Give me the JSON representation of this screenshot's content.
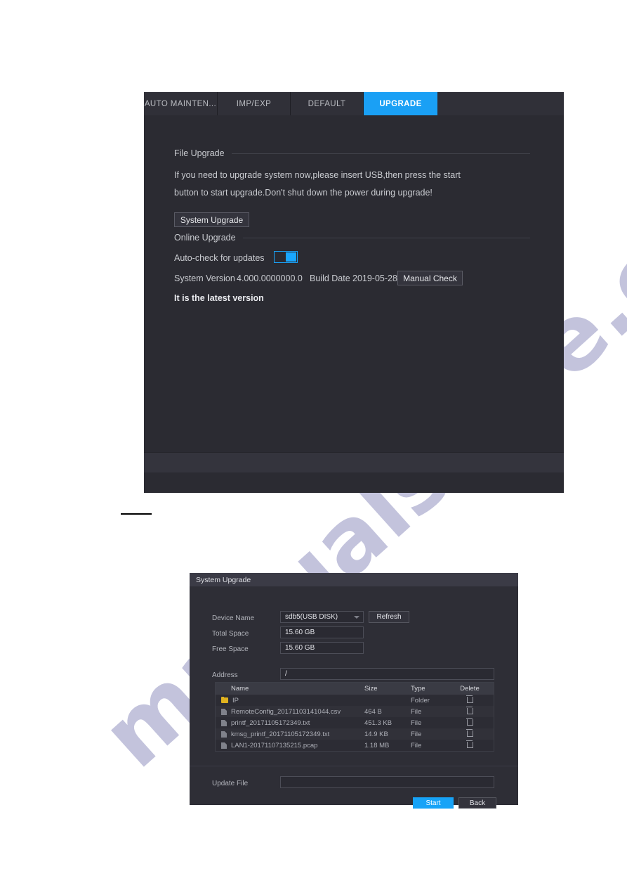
{
  "watermark": {
    "text": "manualshive.com"
  },
  "settings_panel": {
    "tabs": [
      {
        "label": "AUTO MAINTEN...",
        "active": false
      },
      {
        "label": "IMP/EXP",
        "active": false
      },
      {
        "label": "DEFAULT",
        "active": false
      },
      {
        "label": "UPGRADE",
        "active": true
      }
    ],
    "file_upgrade": {
      "section_title": "File Upgrade",
      "description_line1": "If you need to upgrade system now,please insert USB,then press the start",
      "description_line2": "button to start upgrade.Don't shut down the power during upgrade!",
      "system_upgrade_button": "System Upgrade"
    },
    "online_upgrade": {
      "section_title": "Online Upgrade",
      "auto_check_label": "Auto-check for updates",
      "auto_check_enabled": true,
      "system_version_label": "System Version",
      "system_version_value": "4.000.0000000.0",
      "build_date_label": "Build Date",
      "build_date_value": "2019-05-28",
      "manual_check_button": "Manual Check",
      "status_text": "It is the latest version"
    },
    "accent_color": "#1aa0f5"
  },
  "upgrade_dialog": {
    "title": "System Upgrade",
    "fields": {
      "device_name_label": "Device Name",
      "device_name_value": "sdb5(USB DISK)",
      "refresh_button": "Refresh",
      "total_space_label": "Total Space",
      "total_space_value": "15.60 GB",
      "free_space_label": "Free Space",
      "free_space_value": "15.60 GB",
      "address_label": "Address",
      "address_value": "/",
      "update_file_label": "Update File",
      "update_file_value": ""
    },
    "table": {
      "columns": [
        "Name",
        "Size",
        "Type",
        "Delete"
      ],
      "rows": [
        {
          "name": "IP",
          "size": "",
          "type": "Folder",
          "icon": "folder-icon"
        },
        {
          "name": "RemoteConfig_20171103141044.csv",
          "size": "464 B",
          "type": "File",
          "icon": "file-icon"
        },
        {
          "name": "printf_20171105172349.txt",
          "size": "451.3 KB",
          "type": "File",
          "icon": "file-icon"
        },
        {
          "name": "kmsg_printf_20171105172349.txt",
          "size": "14.9 KB",
          "type": "File",
          "icon": "file-icon"
        },
        {
          "name": "LAN1-20171107135215.pcap",
          "size": "1.18 MB",
          "type": "File",
          "icon": "file-icon"
        }
      ]
    },
    "buttons": {
      "start": "Start",
      "back": "Back"
    },
    "accent_color": "#17a3f7"
  }
}
